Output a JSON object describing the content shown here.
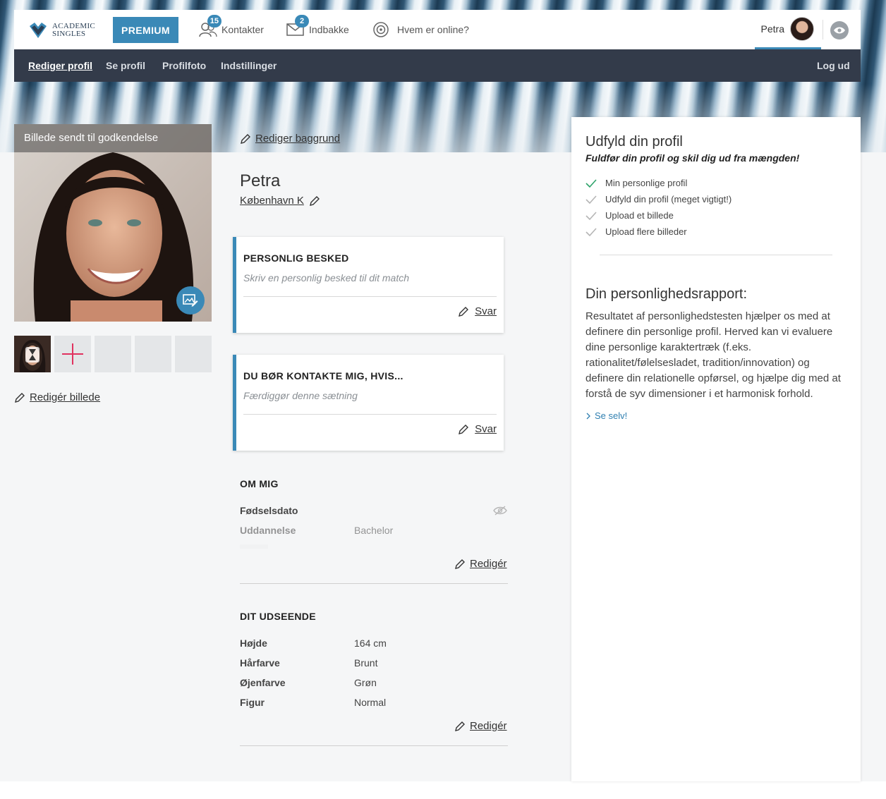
{
  "header": {
    "logo_line1": "ACADEMIC",
    "logo_line2": "SINGLES",
    "premium_label": "PREMIUM",
    "nav": [
      {
        "label": "Kontakter",
        "badge": "15",
        "icon": "contacts-icon"
      },
      {
        "label": "Indbakke",
        "badge": "2",
        "icon": "mail-icon"
      },
      {
        "label": "Hvem er online?",
        "badge": "",
        "icon": "online-icon"
      }
    ],
    "user_name": "Petra"
  },
  "subnav": {
    "items": [
      "Rediger profil",
      "Se profil",
      "Profilfoto",
      "Indstillinger"
    ],
    "logout": "Log ud"
  },
  "photo": {
    "caption": "Billede sendt til godkendelse",
    "edit_label": "Redigér billede"
  },
  "background_edit": "Rediger baggrund",
  "profile": {
    "name": "Petra",
    "city": "København K"
  },
  "cards": [
    {
      "title": "PERSONLIG BESKED",
      "placeholder": "Skriv en personlig besked til dit match",
      "reply": "Svar"
    },
    {
      "title": "DU BØR KONTAKTE MIG, HVIS...",
      "placeholder": "Færdiggør denne sætning",
      "reply": "Svar"
    }
  ],
  "about": {
    "title": "OM MIG",
    "rows": [
      {
        "label": "Fødselsdato",
        "value": ""
      },
      {
        "label": "Uddannelse",
        "value": "Bachelor"
      }
    ],
    "edit": "Redigér"
  },
  "appearance": {
    "title": "DIT UDSEENDE",
    "rows": [
      {
        "label": "Højde",
        "value": "164 cm"
      },
      {
        "label": "Hårfarve",
        "value": "Brunt"
      },
      {
        "label": "Øjenfarve",
        "value": "Grøn"
      },
      {
        "label": "Figur",
        "value": "Normal"
      }
    ],
    "edit": "Redigér"
  },
  "right_panel": {
    "title": "Udfyld din profil",
    "subtitle": "Fuldfør din profil og skil dig ud fra mængden!",
    "checklist": [
      {
        "label": "Min personlige profil",
        "done": true
      },
      {
        "label": "Udfyld din profil (meget vigtigt!)",
        "done": false
      },
      {
        "label": "Upload et billede",
        "done": false
      },
      {
        "label": "Upload flere billeder",
        "done": false
      }
    ],
    "report_title": "Din personlighedsrapport:",
    "report_text": "Resultatet af personlighedstesten hjælper os med at definere din personlige profil. Herved kan vi evaluere dine personlige karaktertræk (f.eks. rationalitet/følelsesladet, tradition/innovation) og definere din relationelle opførsel, og hjælpe dig med at forstå de syv dimensioner i et harmonisk forhold.",
    "link": "Se selv!"
  },
  "colors": {
    "accent": "#3a89b7",
    "subnav_bg": "#333b4a",
    "check_done": "#2fa36b",
    "check_todo": "#b5b5b5",
    "add_photo": "#e0325f"
  }
}
